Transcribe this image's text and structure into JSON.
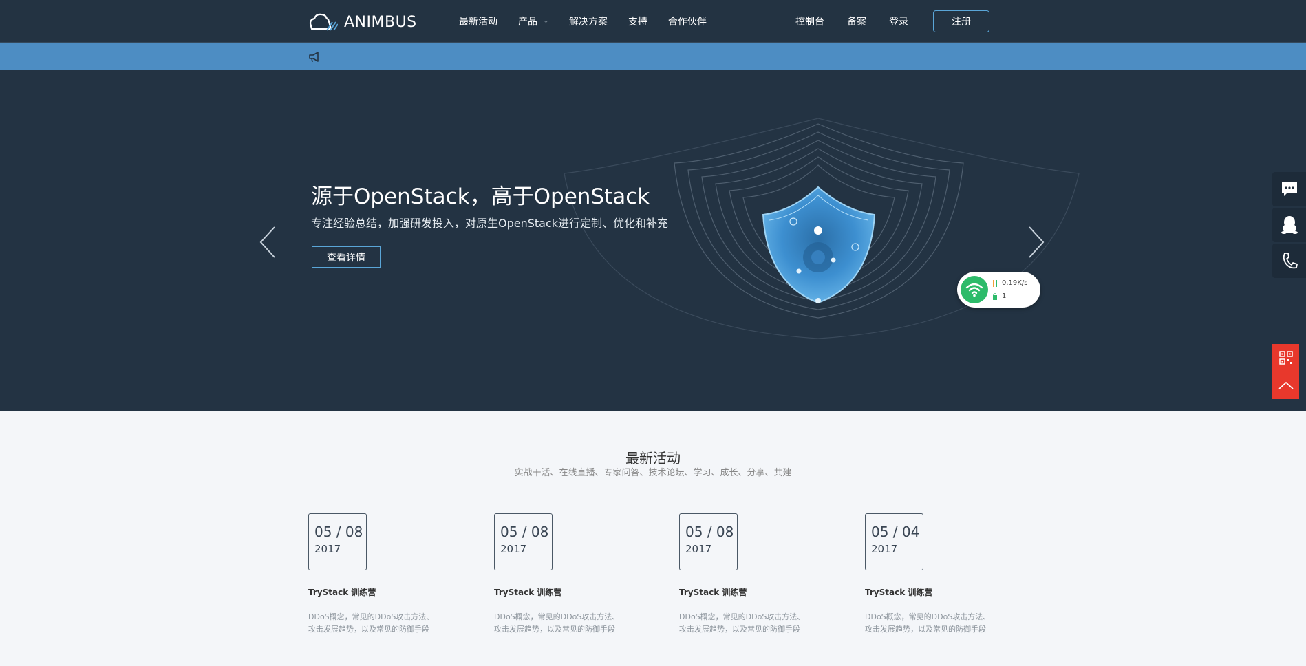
{
  "header": {
    "logo_text": "ANIMBUS",
    "nav": [
      {
        "label": "最新活动"
      },
      {
        "label": "产品",
        "has_dropdown": true
      },
      {
        "label": "解决方案"
      },
      {
        "label": "支持"
      },
      {
        "label": "合作伙伴"
      }
    ],
    "right_nav": [
      {
        "label": "控制台"
      },
      {
        "label": "备案"
      },
      {
        "label": "登录"
      }
    ],
    "register_label": "注册"
  },
  "notice": {
    "icon": "megaphone-icon"
  },
  "hero": {
    "title": "源于OpenStack，高于OpenStack",
    "subtitle": "专注经验总结，加强研发投入，对原生OpenStack进行定制、优化和补充",
    "button_label": "查看详情",
    "prev_icon": "chevron-left-icon",
    "next_icon": "chevron-right-icon"
  },
  "speed_widget": {
    "speed": "0.19K/s",
    "count": "1"
  },
  "side_tools": [
    "chat-icon",
    "qq-penguin-icon",
    "phone-icon",
    "qr-code-icon",
    "back-to-top-icon"
  ],
  "activities": {
    "title": "最新活动",
    "subtitle": "实战干活、在线直播、专家问答、技术论坛、学习、成长、分享、共建",
    "cards": [
      {
        "date": "05 / 08",
        "year": "2017",
        "title": "TryStack 训练营",
        "desc1": "DDoS概念，常见的DDoS攻击方法、",
        "desc2": "攻击发展趋势，以及常见的防御手段"
      },
      {
        "date": "05 / 08",
        "year": "2017",
        "title": "TryStack 训练营",
        "desc1": "DDoS概念，常见的DDoS攻击方法、",
        "desc2": "攻击发展趋势，以及常见的防御手段"
      },
      {
        "date": "05 / 08",
        "year": "2017",
        "title": "TryStack 训练营",
        "desc1": "DDoS概念，常见的DDoS攻击方法、",
        "desc2": "攻击发展趋势，以及常见的防御手段"
      },
      {
        "date": "05 / 04",
        "year": "2017",
        "title": "TryStack 训练营",
        "desc1": "DDoS概念，常见的DDoS攻击方法、",
        "desc2": "攻击发展趋势，以及常见的防御手段"
      }
    ]
  },
  "colors": {
    "header_bg": "#233342",
    "notice_bg": "#4d8dc3",
    "hero_bg": "#233343",
    "accent_border": "#5aa6d8",
    "side_red": "#e8382c",
    "wifi_green": "#2dbb6a"
  }
}
